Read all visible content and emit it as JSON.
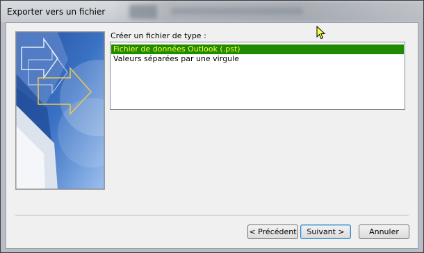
{
  "window": {
    "title": "Exporter vers un fichier"
  },
  "dialog": {
    "type_label": "Créer un fichier de type :",
    "file_types": [
      {
        "label": "Fichier de données Outlook (.pst)",
        "selected": true
      },
      {
        "label": "Valeurs séparées par une virgule",
        "selected": false
      }
    ]
  },
  "buttons": {
    "back": "< Précédent",
    "next": "Suivant >",
    "cancel": "Annuler"
  },
  "colors": {
    "selection_background": "#1f8a00",
    "selection_text": "#fbff3a"
  }
}
